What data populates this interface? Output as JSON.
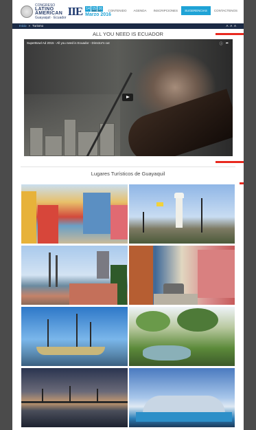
{
  "header": {
    "logo": {
      "line1": "CONGRESO",
      "line2": "LATINO",
      "line3": "AMERICAN",
      "line4": "Guayaquil · Ecuador",
      "acronym": "IIE",
      "days": [
        "14",
        "15",
        "16"
      ],
      "month": "Marzo 2016"
    },
    "nav": [
      {
        "label": "INICIO",
        "active": false
      },
      {
        "label": "CONTENIDO",
        "active": false
      },
      {
        "label": "AGENDA",
        "active": false
      },
      {
        "label": "INSCRIPCIONES",
        "active": false
      },
      {
        "label": "SUGERENCIAS",
        "active": true
      },
      {
        "label": "CONTACTENOS",
        "active": false
      }
    ]
  },
  "breadcrumb": {
    "home": "Inicio",
    "separator": "»",
    "current": "Turismo",
    "font_size_control": "A A A"
  },
  "video_section": {
    "title": "ALL YOU NEED IS ECUADOR",
    "video_title": "SuperBowl Ad 2015 - All you need is Ecuador - Director's cut",
    "icons": [
      "info-icon",
      "share-icon",
      "play-icon"
    ]
  },
  "gallery_section": {
    "title": "Lugares Turísticos de Guayaquil",
    "photos": [
      {
        "subject": "colorful-houses-stairs"
      },
      {
        "subject": "lighthouse-plaza"
      },
      {
        "subject": "malecon-sailboat"
      },
      {
        "subject": "las-penas-street"
      },
      {
        "subject": "pirate-ship-river"
      },
      {
        "subject": "park-gardens"
      },
      {
        "subject": "sunset-bridge"
      },
      {
        "subject": "modern-building"
      }
    ]
  },
  "colors": {
    "accent": "#1fa3d6",
    "breadcrumb_bg": "#1b2a45",
    "annotation": "#e8291f",
    "page_bg": "#4b4b4b"
  }
}
